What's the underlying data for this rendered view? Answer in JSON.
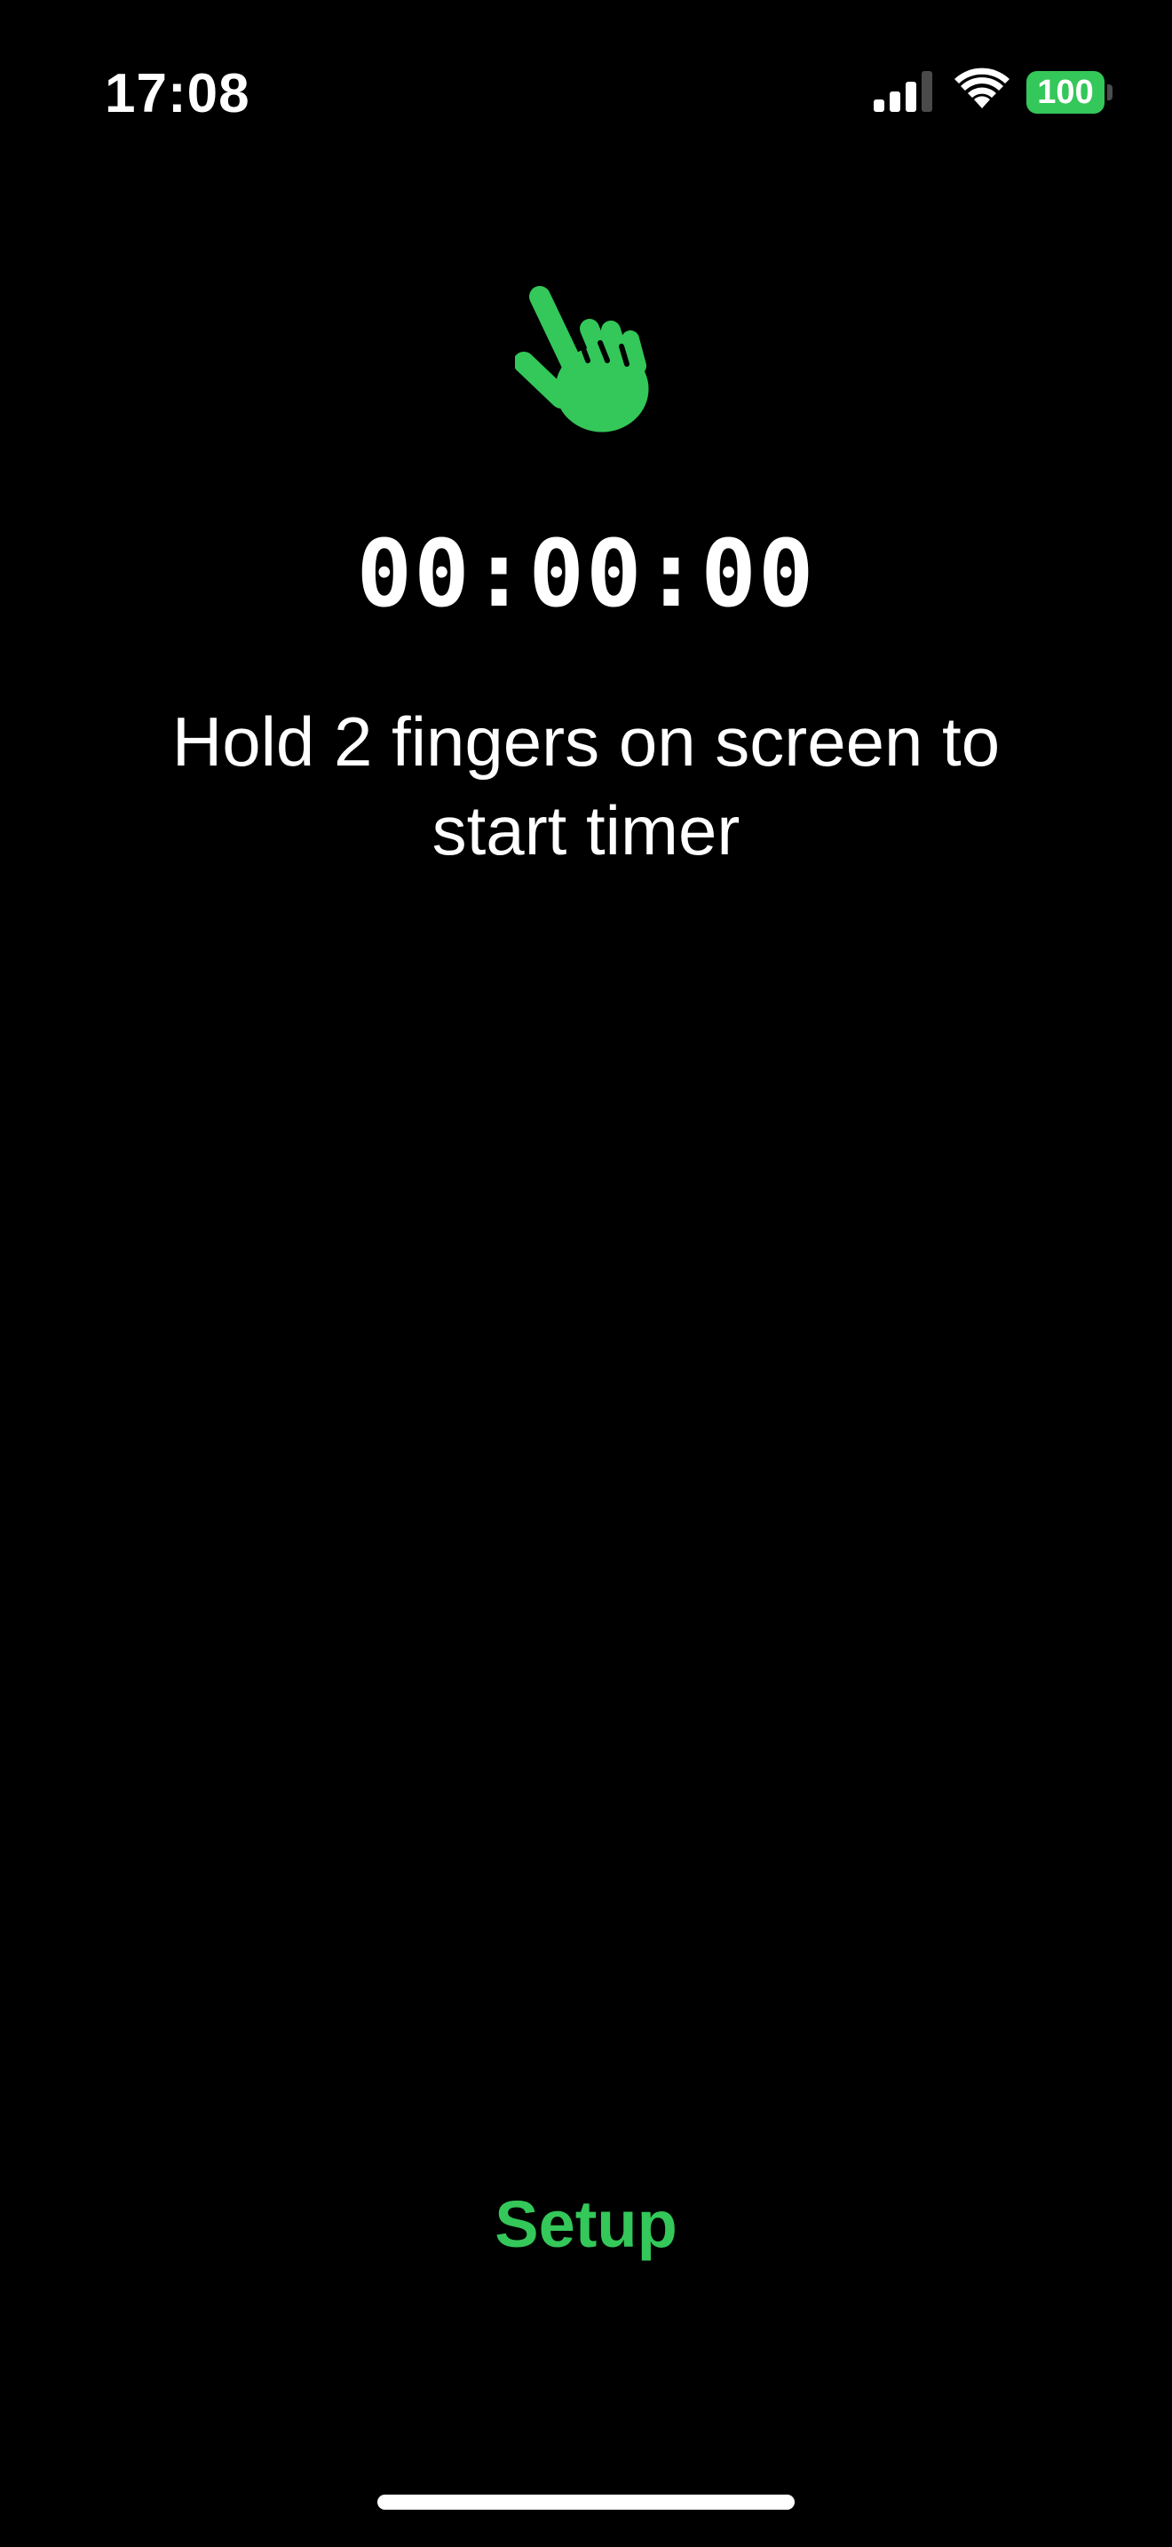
{
  "status_bar": {
    "time": "17:08",
    "battery_level": "100",
    "cell_signal_bars_active": 3,
    "cell_signal_bars_total": 4,
    "icons": [
      "cellular-signal-icon",
      "wifi-icon",
      "battery-icon"
    ]
  },
  "main": {
    "icon": "hand-point-icon",
    "timer": "00:00:00",
    "instruction": "Hold 2 fingers on screen to start timer"
  },
  "footer": {
    "setup_label": "Setup"
  },
  "colors": {
    "background": "#000000",
    "accent": "#34c759",
    "text": "#ffffff"
  }
}
